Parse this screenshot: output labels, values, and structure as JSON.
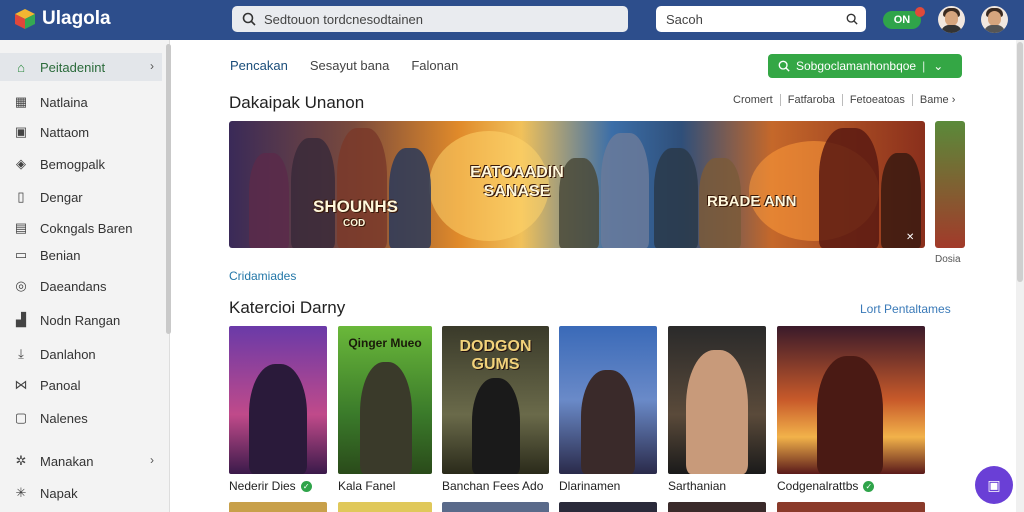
{
  "app": {
    "name": "Ulagola"
  },
  "header": {
    "search_main": "Sedtouon tordcnesodtainen",
    "search_secondary": "Sacoh",
    "toggle_label": "ON"
  },
  "sidebar": {
    "items": [
      {
        "label": "Peitadenint",
        "icon": "home-icon",
        "active": true,
        "chevron": true
      },
      {
        "label": "Natlaina",
        "icon": "calendar-icon"
      },
      {
        "label": "Nattaom",
        "icon": "image-icon"
      },
      {
        "label": "Bemogpalk",
        "icon": "puzzle-icon"
      },
      {
        "label": "Dengar",
        "icon": "bookmark-icon"
      },
      {
        "label": "Cokngals Baren",
        "icon": "grid-icon"
      },
      {
        "label": "Benian",
        "icon": "screen-icon"
      },
      {
        "label": "Daeandans",
        "icon": "compass-icon"
      },
      {
        "label": "Nodn Rangan",
        "icon": "shop-icon"
      },
      {
        "label": "Danlahon",
        "icon": "download-icon"
      },
      {
        "label": "Panoal",
        "icon": "share-icon"
      },
      {
        "label": "Nalenes",
        "icon": "box-icon"
      },
      {
        "label": "Manakan",
        "icon": "settings-icon",
        "chevron": true
      },
      {
        "label": "Napak",
        "icon": "network-icon"
      }
    ]
  },
  "main": {
    "tabs": [
      "Pencakan",
      "Sesayut bana",
      "Falonan"
    ],
    "action_button": "Sobgoclamanhonbqoe",
    "featured_title": "Dakaipak Unanon",
    "filters": [
      "Cromert",
      "Fatfaroba",
      "Fetoeatoas",
      "Bame"
    ],
    "banner": {
      "left_text": "SHOUNHS",
      "left_sub": "COD",
      "center_text": "EATOAADIN SANASE",
      "right_text": "RBADE ANN"
    },
    "banner_caption": "Dosia",
    "link_small": "Cridamiades",
    "section2_title": "Katercioi Darny",
    "section2_link": "Lort Pentaltames",
    "cards": [
      {
        "title": "",
        "label": "Nederir Dies",
        "verified": true
      },
      {
        "title": "Qinger Mueo",
        "label": "Kala Fanel",
        "verified": false
      },
      {
        "title": "DODGON GUMS",
        "label": "Banchan Fees Ado",
        "verified": false
      },
      {
        "title": "",
        "label": "Dlarinamen",
        "verified": false
      },
      {
        "title": "",
        "label": "Sarthanian",
        "verified": false
      },
      {
        "title": "",
        "label": "Codgenalrattbs",
        "verified": true
      }
    ]
  }
}
